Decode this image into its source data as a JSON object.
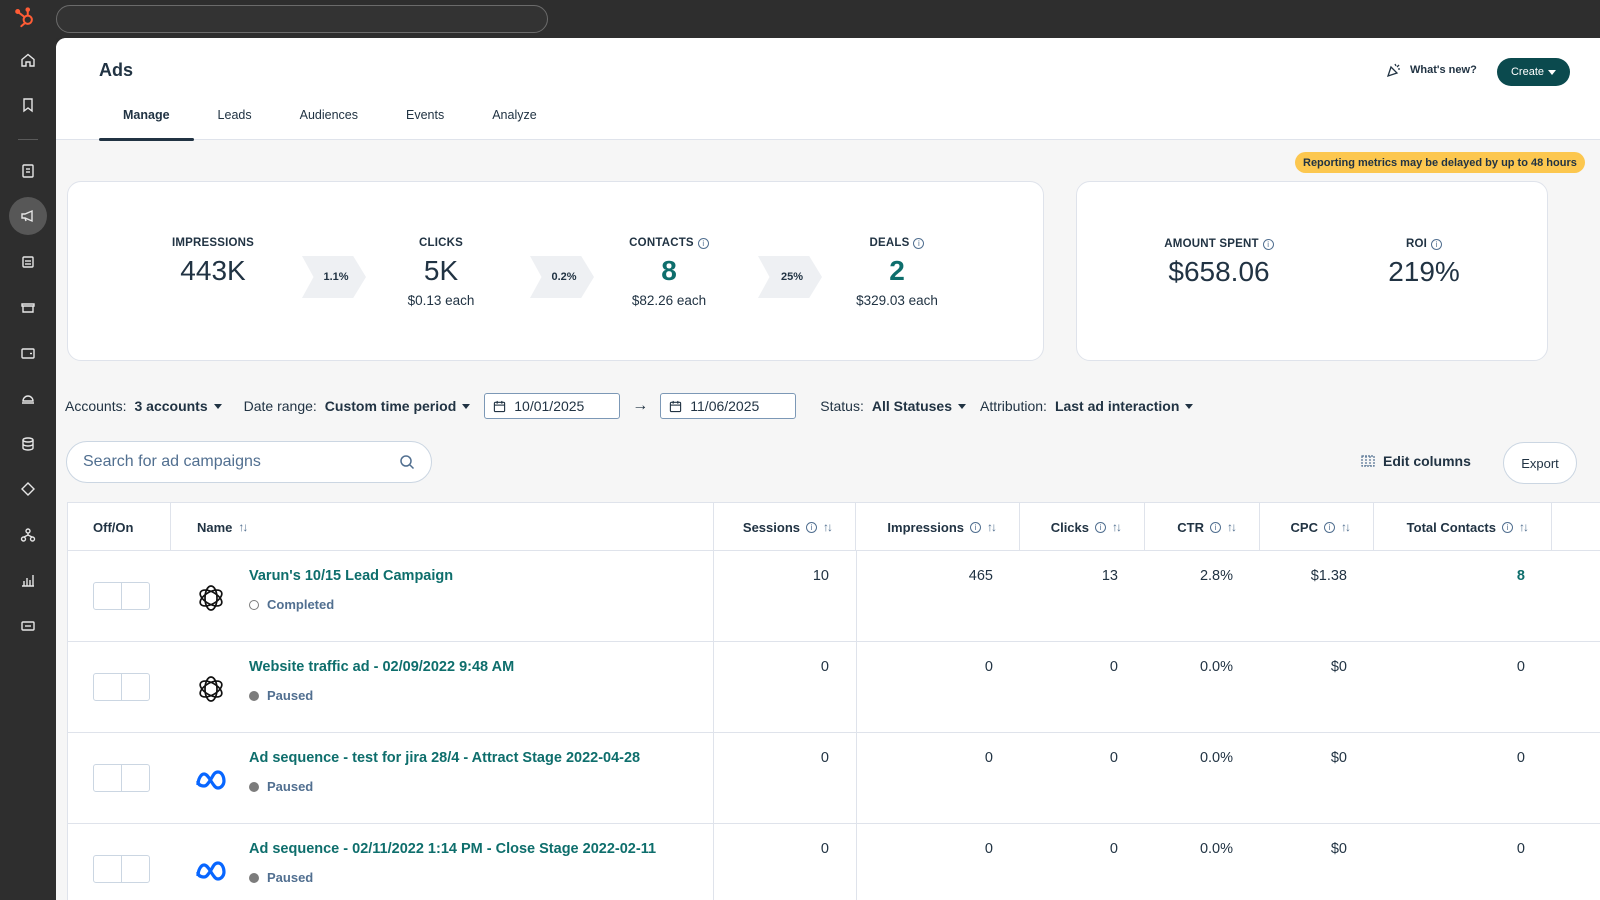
{
  "app": {
    "title": "Ads",
    "whats_new": "What's new?",
    "create": "Create"
  },
  "tabs": [
    "Manage",
    "Leads",
    "Audiences",
    "Events",
    "Analyze"
  ],
  "active_tab": "Manage",
  "notice": "Reporting metrics may be delayed by up to 48 hours",
  "funnel": {
    "impressions": {
      "label": "IMPRESSIONS",
      "value": "443K"
    },
    "rate1": "1.1%",
    "clicks": {
      "label": "CLICKS",
      "value": "5K",
      "sub": "$0.13 each"
    },
    "rate2": "0.2%",
    "contacts": {
      "label": "CONTACTS",
      "value": "8",
      "sub": "$82.26 each"
    },
    "rate3": "25%",
    "deals": {
      "label": "DEALS",
      "value": "2",
      "sub": "$329.03 each"
    }
  },
  "spend": {
    "amount_label": "AMOUNT SPENT",
    "amount_value": "$658.06",
    "roi_label": "ROI",
    "roi_value": "219%"
  },
  "filters": {
    "accounts_label": "Accounts:",
    "accounts_value": "3 accounts",
    "date_label": "Date range:",
    "date_value": "Custom time period",
    "start_date": "10/01/2025",
    "end_date": "11/06/2025",
    "status_label": "Status:",
    "status_value": "All Statuses",
    "attribution_label": "Attribution:",
    "attribution_value": "Last ad interaction"
  },
  "search": {
    "placeholder": "Search for ad campaigns"
  },
  "edit_columns": "Edit columns",
  "export": "Export",
  "columns": {
    "off_on": "Off/On",
    "name": "Name",
    "sessions": "Sessions",
    "impressions": "Impressions",
    "clicks": "Clicks",
    "ctr": "CTR",
    "cpc": "CPC",
    "total_contacts": "Total Contacts"
  },
  "rows": [
    {
      "name": "Varun's 10/15 Lead Campaign",
      "status": "Completed",
      "platform": "openai-icon",
      "sessions": "10",
      "impressions": "465",
      "clicks": "13",
      "ctr": "2.8%",
      "cpc": "$1.38",
      "contacts": "8"
    },
    {
      "name": "Website traffic ad - 02/09/2022 9:48 AM",
      "status": "Paused",
      "platform": "openai-icon",
      "sessions": "0",
      "impressions": "0",
      "clicks": "0",
      "ctr": "0.0%",
      "cpc": "$0",
      "contacts": "0"
    },
    {
      "name": "Ad sequence - test for jira 28/4 - Attract Stage 2022-04-28",
      "status": "Paused",
      "platform": "meta-icon",
      "sessions": "0",
      "impressions": "0",
      "clicks": "0",
      "ctr": "0.0%",
      "cpc": "$0",
      "contacts": "0"
    },
    {
      "name": "Ad sequence - 02/11/2022 1:14 PM - Close Stage 2022-02-11",
      "status": "Paused",
      "platform": "meta-icon",
      "sessions": "0",
      "impressions": "0",
      "clicks": "0",
      "ctr": "0.0%",
      "cpc": "$0",
      "contacts": "0"
    }
  ],
  "colors": {
    "brand": "#ff5c35",
    "accent": "#0e6e6c",
    "create_button": "#0b4a4e",
    "notice": "#fcc74f"
  }
}
